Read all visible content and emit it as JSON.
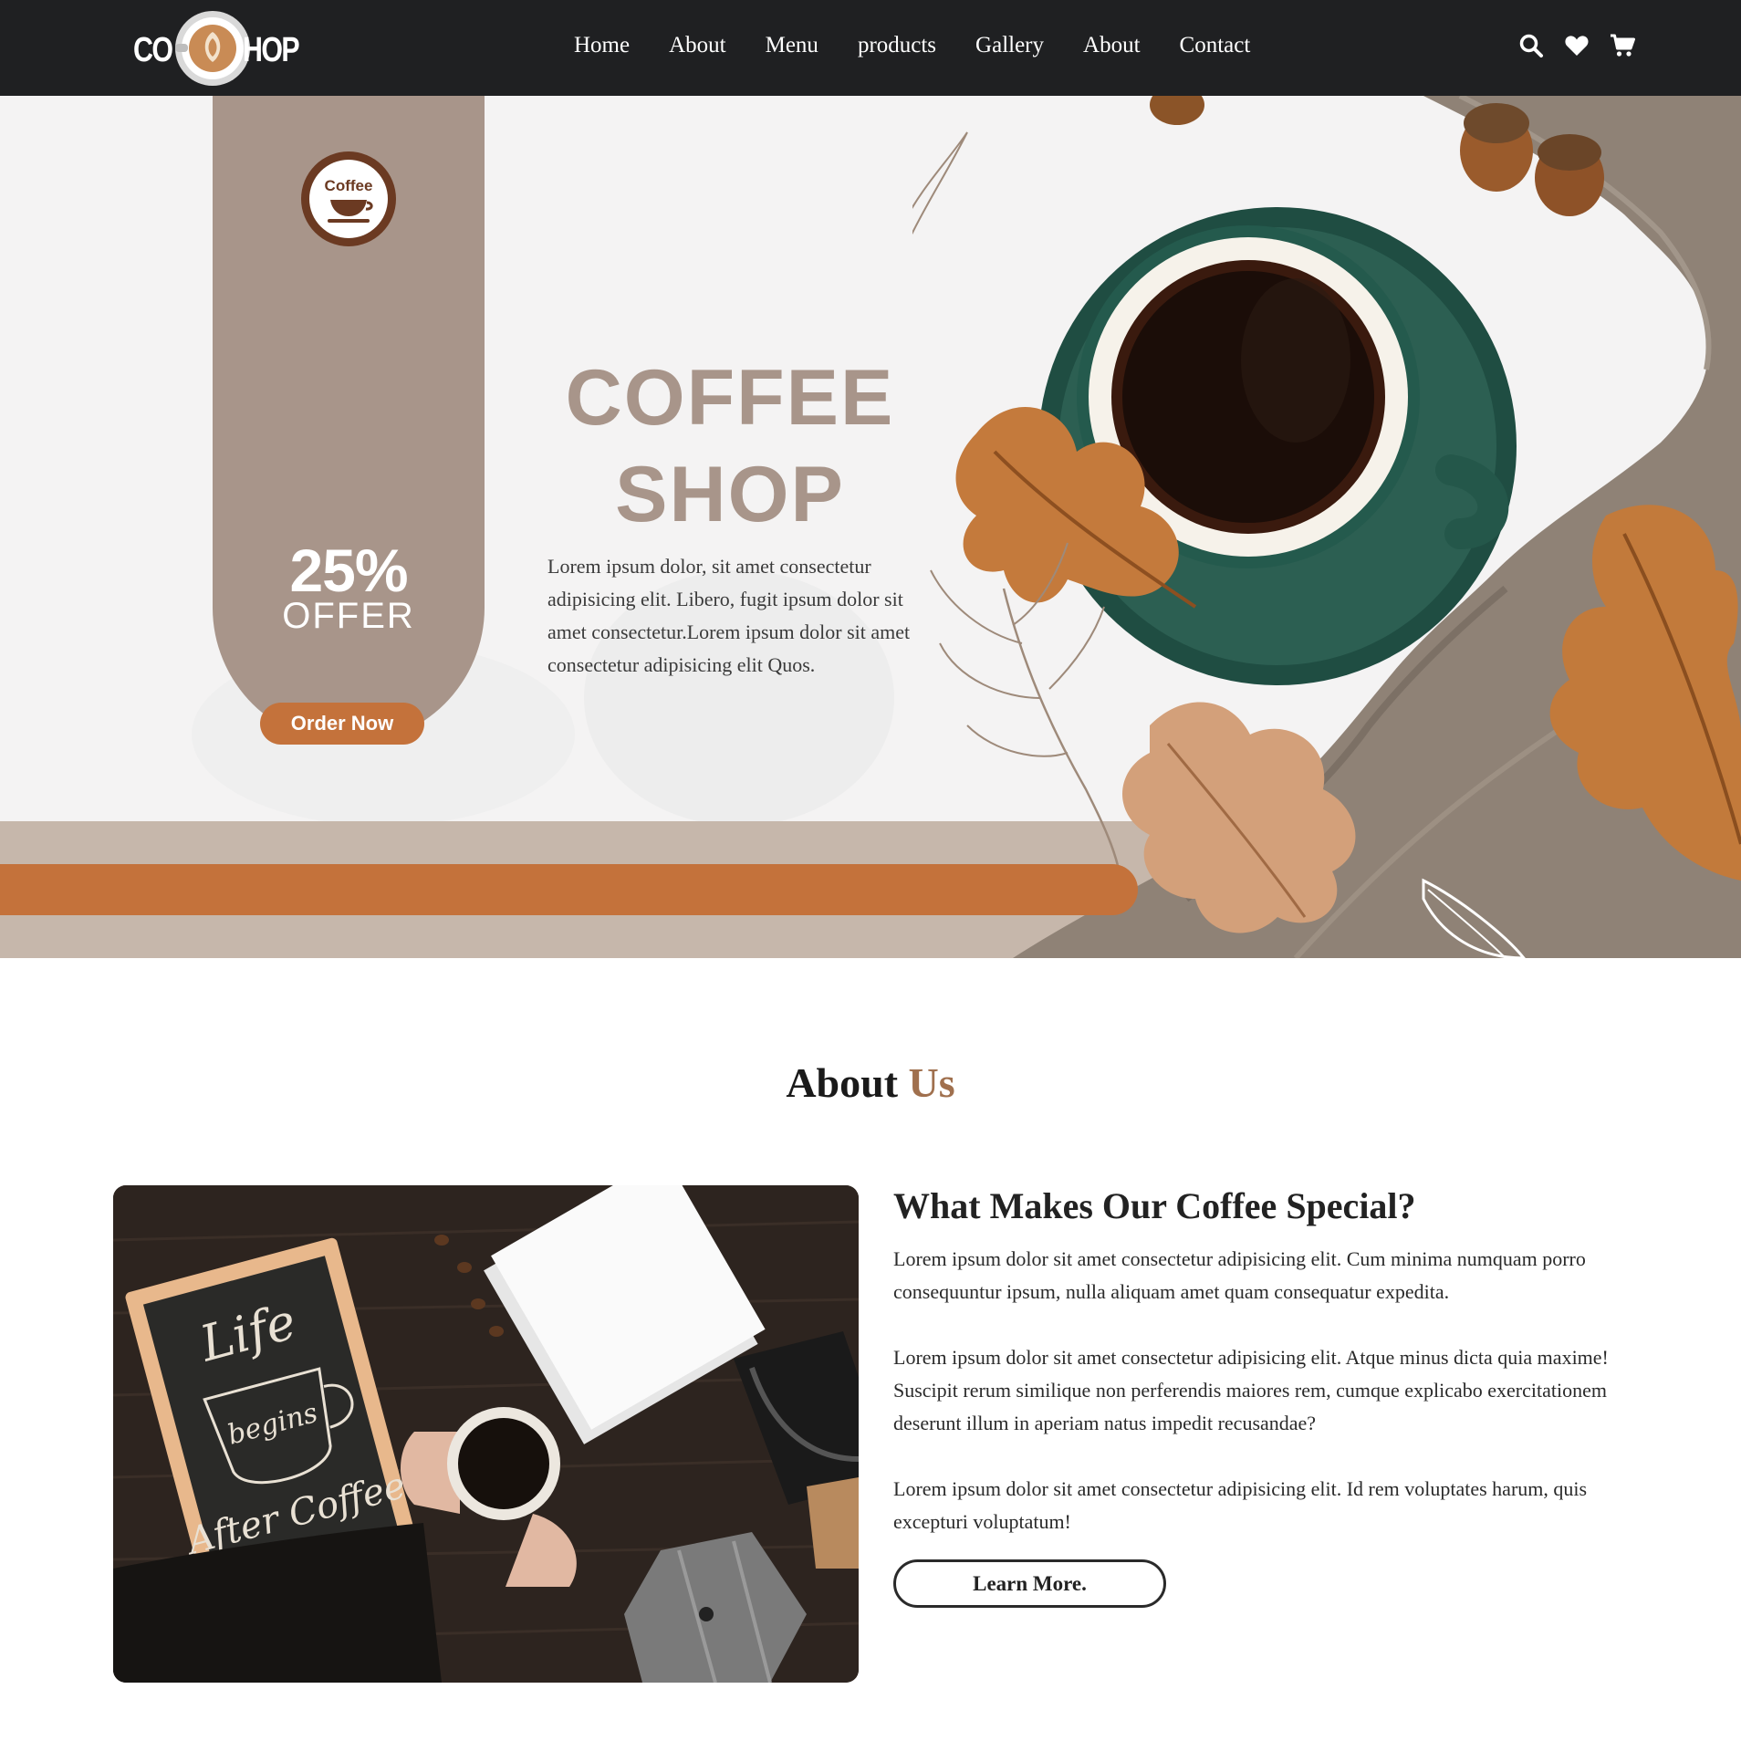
{
  "nav": {
    "logo_left": "CO",
    "logo_right": "HOP",
    "links": [
      "Home",
      "About",
      "Menu",
      "products",
      "Gallery",
      "About",
      "Contact"
    ],
    "icons": [
      "search-icon",
      "heart-icon",
      "cart-icon"
    ]
  },
  "hero": {
    "badge_text": "Coffee",
    "offer_percent": "25%",
    "offer_word": "OFFER",
    "order_button": "Order Now",
    "title_line1": "COFFEE",
    "title_line2": "SHOP",
    "description": "Lorem ipsum dolor, sit amet consectetur adipisicing elit. Libero, fugit ipsum dolor sit amet consectetur.Lorem ipsum dolor sit amet consectetur adipisicing elit Quos."
  },
  "about": {
    "heading_main": "About",
    "heading_accent": "Us",
    "chalkboard_lettering": "Life begins After Coffee",
    "subheading": "What Makes Our Coffee Special?",
    "paragraphs": [
      "Lorem ipsum dolor sit amet consectetur adipisicing elit. Cum minima numquam porro consequuntur ipsum, nulla aliquam amet quam consequatur expedita.",
      "Lorem ipsum dolor sit amet consectetur adipisicing elit. Atque minus dicta quia maxime! Suscipit rerum similique non perferendis maiores rem, cumque explicabo exercitationem deserunt illum in aperiam natus impedit recusandae?",
      "Lorem ipsum dolor sit amet consectetur adipisicing elit. Id rem voluptates harum, quis excepturi voluptatum!"
    ],
    "learn_button": "Learn More."
  },
  "colors": {
    "nav_bg": "#1f2022",
    "brand_taupe": "#a8958a",
    "accent_orange": "#c4723b",
    "accent_brown": "#a0704e"
  }
}
